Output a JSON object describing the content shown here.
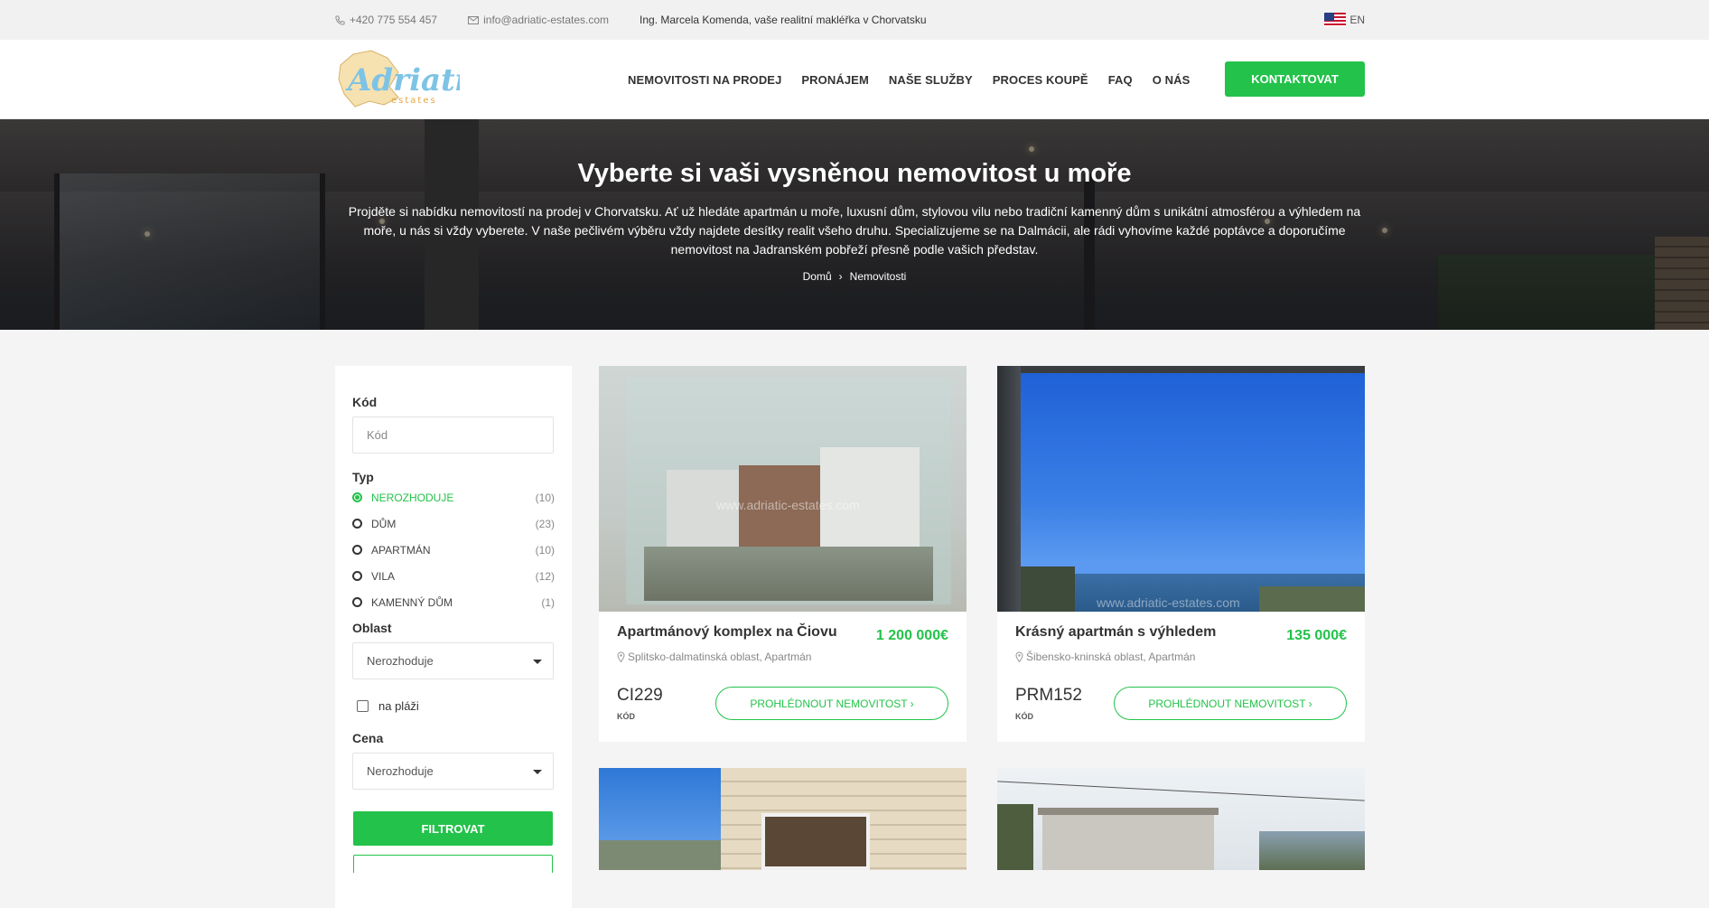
{
  "topbar": {
    "phone": "+420 775 554 457",
    "email": "info@adriatic-estates.com",
    "tagline": "Ing. Marcela Komenda, vaše realitní makléřka v Chorvatsku",
    "lang": "EN"
  },
  "header": {
    "logo_text": "Adriatic",
    "logo_sub": "estates",
    "nav": [
      "NEMOVITOSTI NA PRODEJ",
      "PRONÁJEM",
      "NAŠE SLUŽBY",
      "PROCES KOUPĚ",
      "FAQ",
      "O NÁS"
    ],
    "cta": "KONTAKTOVAT"
  },
  "hero": {
    "title": "Vyberte si vaši vysněnou nemovitost u moře",
    "text": "Projděte si nabídku nemovitostí na prodej v Chorvatsku. Ať už hledáte apartmán u moře, luxusní dům, stylovou vilu nebo tradiční kamenný dům s unikátní atmosférou a výhledem na moře, u nás si vždy vyberete. V naše pečlivém výběru vždy najdete desítky realit všeho druhu. Specializujeme se na Dalmácii, ale rádi vyhovíme každé poptávce a doporučíme nemovitost na Jadranském pobřeží přesně podle vašich představ.",
    "breadcrumb": [
      "Domů",
      "Nemovitosti"
    ],
    "breadcrumb_sep": "›"
  },
  "filter": {
    "code_label": "Kód",
    "code_placeholder": "Kód",
    "type_label": "Typ",
    "types": [
      {
        "label": "NEROZHODUJE",
        "count": "(10)",
        "active": true
      },
      {
        "label": "DŮM",
        "count": "(23)"
      },
      {
        "label": "APARTMÁN",
        "count": "(10)"
      },
      {
        "label": "VILA",
        "count": "(12)"
      },
      {
        "label": "KAMENNÝ DŮM",
        "count": "(1)"
      }
    ],
    "area_label": "Oblast",
    "area_value": "Nerozhoduje",
    "beach_label": "na pláži",
    "price_label": "Cena",
    "price_value": "Nerozhoduje",
    "submit": "FILTROVAT"
  },
  "listings": [
    {
      "title": "Apartmánový komplex na Čiovu",
      "price": "1 200 000€",
      "location": "Splitsko-dalmatinská oblast, Apartmán",
      "code": "CI229",
      "code_label": "KÓD",
      "button": "PROHLÉDNOUT NEMOVITOST  ›"
    },
    {
      "title": "Krásný apartmán s výhledem",
      "price": "135 000€",
      "location": "Šibensko-kninská oblast, Apartmán",
      "code": "PRM152",
      "code_label": "KÓD",
      "button": "PROHLÉDNOUT NEMOVITOST  ›"
    }
  ],
  "watermark": "www.adriatic-estates.com",
  "colors": {
    "accent": "#23c24a",
    "topbar_bg": "#f1f1f1",
    "page_bg": "#f4f4f4"
  }
}
